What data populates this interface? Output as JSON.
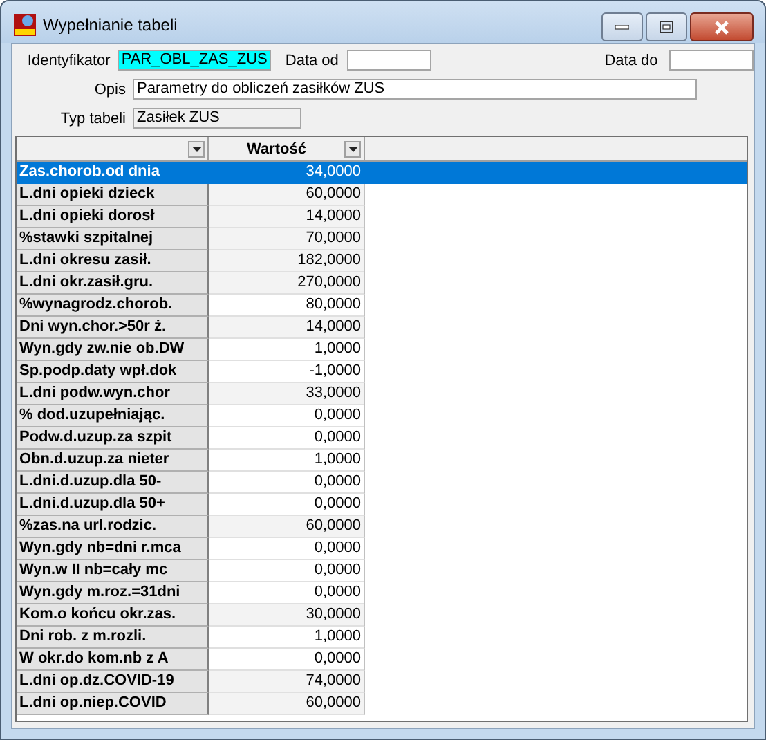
{
  "window": {
    "title": "Wypełnianie tabeli"
  },
  "form": {
    "identyfikator_label": "Identyfikator",
    "identyfikator": "PAR_OBL_ZAS_ZUS",
    "data_od_label": "Data od",
    "data_do_label": "Data do",
    "opis_label": "Opis",
    "opis": "Parametry do obliczeń zasiłków ZUS",
    "typ_label": "Typ tabeli",
    "typ": "Zasiłek ZUS"
  },
  "table": {
    "columns": [
      "Wartość"
    ],
    "rows": [
      {
        "name": "Zas.chorob.od dnia",
        "value": "34,0000",
        "selected": true,
        "shaded": false
      },
      {
        "name": "L.dni opieki dzieck",
        "value": "60,0000",
        "selected": false,
        "shaded": true
      },
      {
        "name": "L.dni opieki dorosł",
        "value": "14,0000",
        "selected": false,
        "shaded": true
      },
      {
        "name": "%stawki szpitalnej",
        "value": "70,0000",
        "selected": false,
        "shaded": true
      },
      {
        "name": "L.dni okresu zasił.",
        "value": "182,0000",
        "selected": false,
        "shaded": true
      },
      {
        "name": "L.dni okr.zasił.gru.",
        "value": "270,0000",
        "selected": false,
        "shaded": true
      },
      {
        "name": "%wynagrodz.chorob.",
        "value": "80,0000",
        "selected": false,
        "shaded": false
      },
      {
        "name": "Dni wyn.chor.>50r ż.",
        "value": "14,0000",
        "selected": false,
        "shaded": true
      },
      {
        "name": "Wyn.gdy zw.nie ob.DW",
        "value": "1,0000",
        "selected": false,
        "shaded": false
      },
      {
        "name": "Sp.podp.daty wpł.dok",
        "value": "-1,0000",
        "selected": false,
        "shaded": false
      },
      {
        "name": "L.dni podw.wyn.chor",
        "value": "33,0000",
        "selected": false,
        "shaded": true
      },
      {
        "name": "% dod.uzupełniając.",
        "value": "0,0000",
        "selected": false,
        "shaded": false
      },
      {
        "name": "Podw.d.uzup.za szpit",
        "value": "0,0000",
        "selected": false,
        "shaded": false
      },
      {
        "name": "Obn.d.uzup.za nieter",
        "value": "1,0000",
        "selected": false,
        "shaded": false
      },
      {
        "name": "L.dni.d.uzup.dla 50-",
        "value": "0,0000",
        "selected": false,
        "shaded": false
      },
      {
        "name": "L.dni.d.uzup.dla 50+",
        "value": "0,0000",
        "selected": false,
        "shaded": false
      },
      {
        "name": "%zas.na url.rodzic.",
        "value": "60,0000",
        "selected": false,
        "shaded": true
      },
      {
        "name": "Wyn.gdy nb=dni r.mca",
        "value": "0,0000",
        "selected": false,
        "shaded": false
      },
      {
        "name": "Wyn.w II nb=cały mc",
        "value": "0,0000",
        "selected": false,
        "shaded": false
      },
      {
        "name": "Wyn.gdy m.roz.=31dni",
        "value": "0,0000",
        "selected": false,
        "shaded": false
      },
      {
        "name": "Kom.o końcu okr.zas.",
        "value": "30,0000",
        "selected": false,
        "shaded": true
      },
      {
        "name": "Dni rob. z m.rozli.",
        "value": "1,0000",
        "selected": false,
        "shaded": false
      },
      {
        "name": "W okr.do kom.nb z A",
        "value": "0,0000",
        "selected": false,
        "shaded": false
      },
      {
        "name": "L.dni op.dz.COVID-19",
        "value": "74,0000",
        "selected": false,
        "shaded": true
      },
      {
        "name": "L.dni op.niep.COVID",
        "value": "60,0000",
        "selected": false,
        "shaded": true
      }
    ]
  }
}
